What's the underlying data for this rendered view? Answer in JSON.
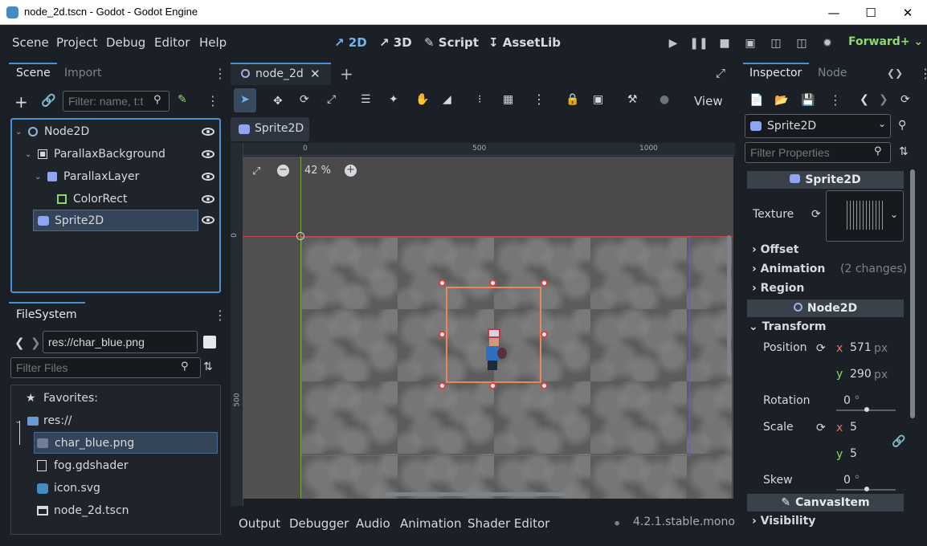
{
  "window": {
    "title": "node_2d.tscn - Godot - Godot Engine"
  },
  "menu": [
    "Scene",
    "Project",
    "Debug",
    "Editor",
    "Help"
  ],
  "modes": [
    {
      "label": "2D",
      "active": true
    },
    {
      "label": "3D",
      "active": false
    },
    {
      "label": "Script",
      "active": false
    },
    {
      "label": "AssetLib",
      "active": false
    }
  ],
  "renderer": "Forward+",
  "scene_dock": {
    "tabs": [
      "Scene",
      "Import"
    ],
    "filter_placeholder": "Filter: name, t:t",
    "tree": [
      {
        "label": "Node2D",
        "icon": "node2d-icon"
      },
      {
        "label": "ParallaxBackground",
        "icon": "parallax-background-icon"
      },
      {
        "label": "ParallaxLayer",
        "icon": "parallax-layer-icon"
      },
      {
        "label": "ColorRect",
        "icon": "colorrect-icon"
      },
      {
        "label": "Sprite2D",
        "icon": "sprite2d-icon",
        "selected": true
      }
    ]
  },
  "filesystem": {
    "title": "FileSystem",
    "path": "res://char_blue.png",
    "filter_placeholder": "Filter Files",
    "items": [
      {
        "label": "Favorites:",
        "icon": "star-icon"
      },
      {
        "label": "res://",
        "icon": "folder-icon"
      },
      {
        "label": "char_blue.png",
        "icon": "image-icon",
        "selected": true
      },
      {
        "label": "fog.gdshader",
        "icon": "shader-icon"
      },
      {
        "label": "icon.svg",
        "icon": "svg-icon"
      },
      {
        "label": "node_2d.tscn",
        "icon": "scene-icon"
      }
    ]
  },
  "editor_tabs": {
    "active": "node_2d"
  },
  "viewport": {
    "view_label": "View",
    "breadcrumb": "Sprite2D",
    "zoom": "42 %",
    "ruler_h": [
      "0",
      "500",
      "1000"
    ],
    "ruler_v": [
      "0",
      "500"
    ]
  },
  "bottom_tabs": [
    "Output",
    "Debugger",
    "Audio",
    "Animation",
    "Shader Editor"
  ],
  "version": "4.2.1.stable.mono",
  "inspector": {
    "tabs": [
      "Inspector",
      "Node"
    ],
    "node_selector": "Sprite2D",
    "filter_placeholder": "Filter Properties",
    "class_header": "Sprite2D",
    "texture_label": "Texture",
    "sections": [
      {
        "label": "Offset",
        "note": ""
      },
      {
        "label": "Animation",
        "note": "(2 changes)"
      },
      {
        "label": "Region",
        "note": ""
      }
    ],
    "node2d_header": "Node2D",
    "transform": {
      "label": "Transform",
      "position_label": "Position",
      "position_x": "571",
      "position_y": "290",
      "unit": "px",
      "rotation_label": "Rotation",
      "rotation": "0",
      "scale_label": "Scale",
      "scale_x": "5",
      "scale_y": "5",
      "skew_label": "Skew",
      "skew": "0",
      "degree": "°"
    },
    "canvasitem_header": "CanvasItem",
    "visibility": "Visibility"
  },
  "colors": {
    "accent": "#4a90d9",
    "renderer": "#8fd86c",
    "selection": "#e8875a"
  }
}
